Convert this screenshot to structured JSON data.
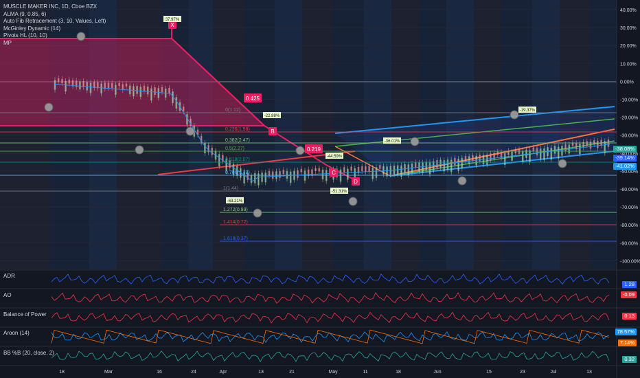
{
  "legend": {
    "title": "MUSCLE MAKER INC, 1D, Cboe BZX",
    "indicators": [
      "ALMA (9, 0.85, 6)",
      "Auto Fib Retracement (3, 10, Values, Left)",
      "McGinley Dynamic (14)",
      "Pivots HL (10, 10)",
      "MP"
    ]
  },
  "price_axis": {
    "ticks": [
      "40.00%",
      "30.00%",
      "20.00%",
      "10.00%",
      "0.00%",
      "-10.00%",
      "-20.00%",
      "-30.00%",
      "-40.00%",
      "-50.00%",
      "-60.00%",
      "-70.00%",
      "-80.00%",
      "-90.00%",
      "-100.00%"
    ],
    "tags": [
      {
        "text": "-38.08%",
        "color": "#26a69a"
      },
      {
        "text": "-39.14%",
        "color": "#2962ff"
      },
      {
        "text": "-41.02%",
        "color": "#2196f3"
      }
    ]
  },
  "time_axis": [
    "18",
    "Mar",
    "16",
    "24",
    "Apr",
    "13",
    "21",
    "May",
    "11",
    "18",
    "Jun",
    "15",
    "23",
    "Jul",
    "13"
  ],
  "fib_levels": [
    {
      "label": "0(1.12)",
      "color": "#787b86"
    },
    {
      "label": "0.236(1.98)",
      "color": "#f23645"
    },
    {
      "label": "0.382(2.47)",
      "color": "#81c784"
    },
    {
      "label": "0.5(2.27)",
      "color": "#4caf50"
    },
    {
      "label": "0.618(2.07)",
      "color": "#009688"
    },
    {
      "label": "0.786(1.78)",
      "color": "#64b5f6"
    },
    {
      "label": "1(1.44)",
      "color": "#787b86"
    },
    {
      "label": "1.272(0.99)",
      "color": "#81c784"
    },
    {
      "label": "1.414(0.72)",
      "color": "#f23645"
    },
    {
      "label": "1.618(0.37)",
      "color": "#2962ff"
    }
  ],
  "pattern_points": [
    "X",
    "B",
    "C",
    "D",
    "D"
  ],
  "ratios": [
    "0.425",
    "0.219"
  ],
  "change_labels": [
    "37.97%",
    "-22.88%",
    "-44.59%",
    "-63.21%",
    "-51.31%",
    "-36.01%",
    "-19.37%"
  ],
  "panes": [
    {
      "name": "ADR",
      "value": "1.28",
      "tag_color": "#2962ff"
    },
    {
      "name": "AO",
      "value": "-0.09",
      "tag_color": "#f23645"
    },
    {
      "name": "Balance of Power",
      "value": "0.13",
      "tag_color": "#f23645"
    },
    {
      "name": "Aroon (14)",
      "value": "78.57%",
      "value2": "7.14%",
      "tag_color": "#2196f3",
      "tag_color2": "#ff6d00"
    },
    {
      "name": "BB %B (20, close, 2)",
      "value": "0.32",
      "tag_color": "#26a69a"
    }
  ]
}
